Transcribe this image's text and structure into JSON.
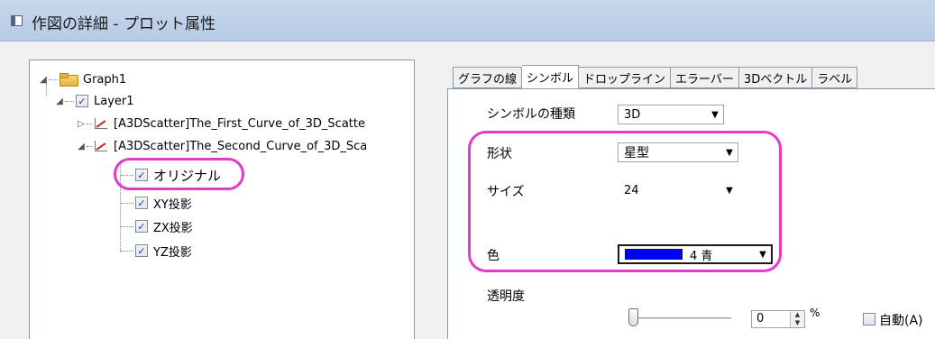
{
  "window": {
    "title": "作図の詳細 - プロット属性"
  },
  "tree": {
    "graph": "Graph1",
    "layer": "Layer1",
    "curve1": "[A3DScatter]The_First_Curve_of_3D_Scatte",
    "curve2": "[A3DScatter]The_Second_Curve_of_3D_Sca",
    "original": "オリジナル",
    "xy": "XY投影",
    "zx": "ZX投影",
    "yz": "YZ投影"
  },
  "tabs": [
    "グラフの線",
    "シンボル",
    "ドロップライン",
    "エラーバー",
    "3Dベクトル",
    "ラベル"
  ],
  "symbol": {
    "type_label": "シンボルの種類",
    "type_value": "3D",
    "shape_label": "形状",
    "shape_value": "星型",
    "size_label": "サイズ",
    "size_value": "24",
    "color_label": "色",
    "color_value": "4 青",
    "color_hex": "#0000ff",
    "transparency_label": "透明度",
    "transparency_value": "0",
    "percent": "%",
    "auto_label": "自動(A)"
  }
}
